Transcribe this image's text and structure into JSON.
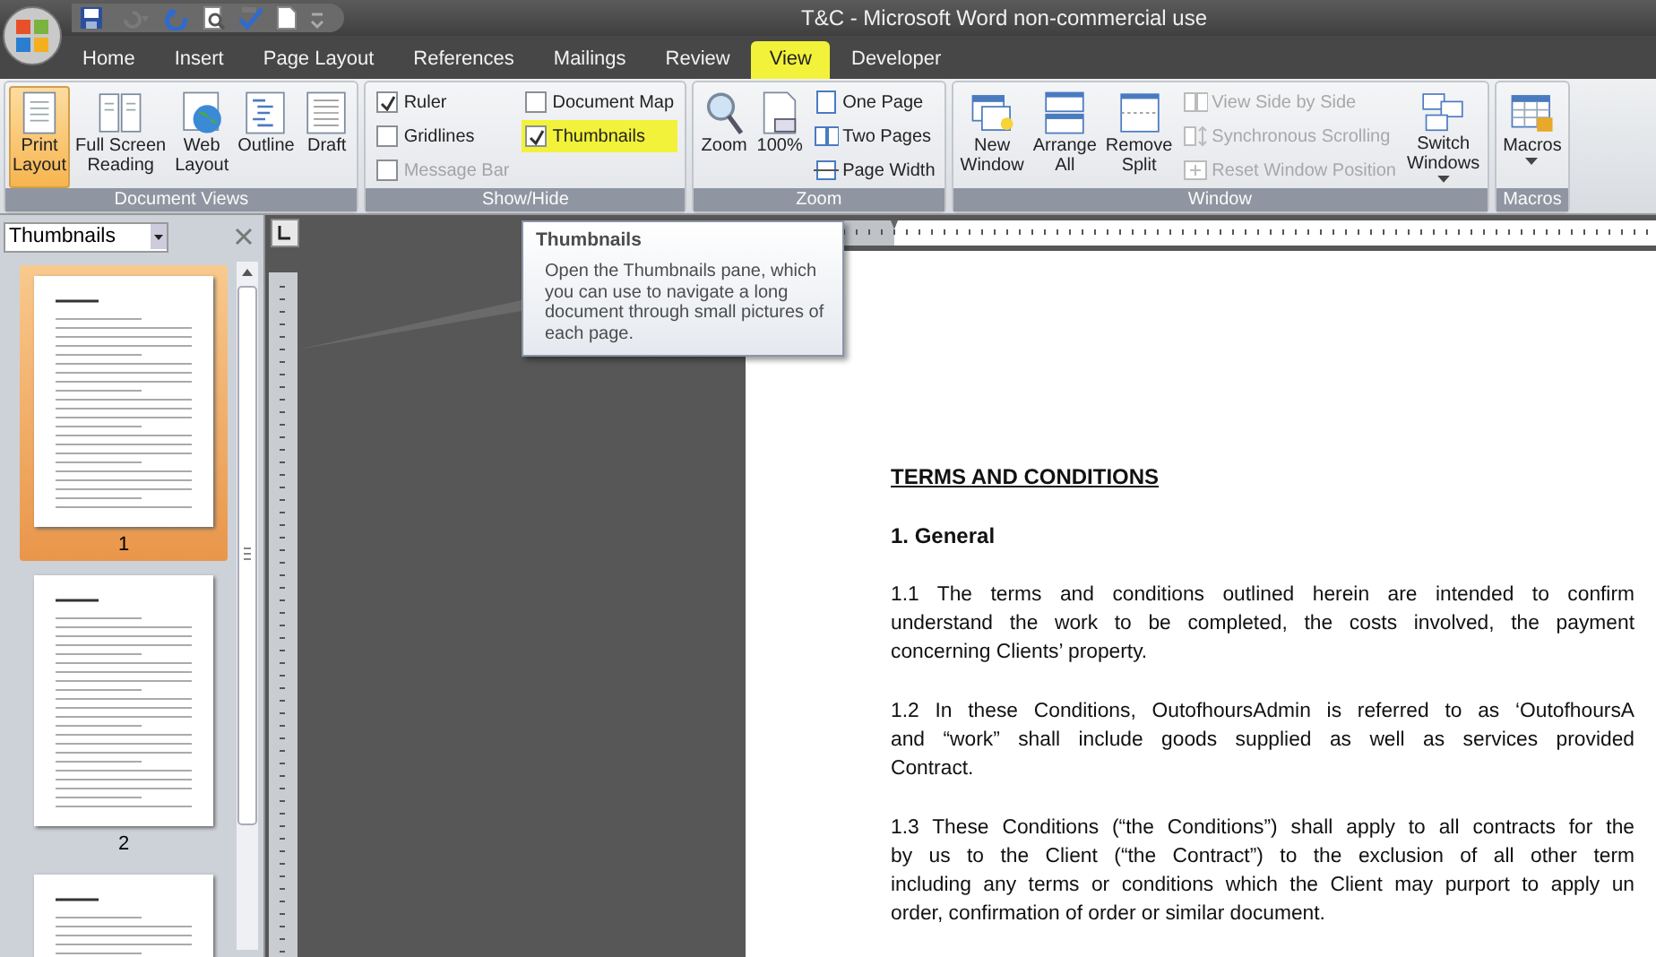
{
  "window": {
    "title": "T&C - Microsoft Word non-commercial use"
  },
  "tabs": [
    {
      "label": "Home",
      "selected": false,
      "highlighted": false
    },
    {
      "label": "Insert",
      "selected": false,
      "highlighted": false
    },
    {
      "label": "Page Layout",
      "selected": false,
      "highlighted": false
    },
    {
      "label": "References",
      "selected": false,
      "highlighted": false
    },
    {
      "label": "Mailings",
      "selected": false,
      "highlighted": false
    },
    {
      "label": "Review",
      "selected": false,
      "highlighted": false
    },
    {
      "label": "View",
      "selected": true,
      "highlighted": true
    },
    {
      "label": "Developer",
      "selected": false,
      "highlighted": false
    }
  ],
  "ribbon": {
    "groups": [
      {
        "label": "Document Views",
        "items": [
          {
            "kind": "large",
            "label_lines": [
              "Print",
              "Layout"
            ],
            "selected": true,
            "disabled": false
          },
          {
            "kind": "large",
            "label_lines": [
              "Full Screen",
              "Reading"
            ],
            "selected": false,
            "disabled": false
          },
          {
            "kind": "large",
            "label_lines": [
              "Web",
              "Layout"
            ],
            "selected": false,
            "disabled": false
          },
          {
            "kind": "large",
            "label_lines": [
              "Outline"
            ],
            "selected": false,
            "disabled": false
          },
          {
            "kind": "large",
            "label_lines": [
              "Draft"
            ],
            "selected": false,
            "disabled": false
          }
        ]
      },
      {
        "label": "Show/Hide",
        "items": [
          {
            "kind": "checkbox",
            "label": "Ruler",
            "checked": true,
            "disabled": false,
            "highlighted": false
          },
          {
            "kind": "checkbox",
            "label": "Gridlines",
            "checked": false,
            "disabled": false,
            "highlighted": false
          },
          {
            "kind": "checkbox",
            "label": "Message Bar",
            "checked": false,
            "disabled": true,
            "highlighted": false
          },
          {
            "kind": "checkbox",
            "label": "Document Map",
            "checked": false,
            "disabled": false,
            "highlighted": false
          },
          {
            "kind": "checkbox",
            "label": "Thumbnails",
            "checked": true,
            "disabled": false,
            "highlighted": true
          }
        ]
      },
      {
        "label": "Zoom",
        "items": [
          {
            "kind": "large",
            "label_lines": [
              "Zoom"
            ],
            "selected": false,
            "disabled": false
          },
          {
            "kind": "large",
            "label_lines": [
              "100%"
            ],
            "selected": false,
            "disabled": false
          },
          {
            "kind": "small",
            "label": "One Page",
            "disabled": false
          },
          {
            "kind": "small",
            "label": "Two Pages",
            "disabled": false
          },
          {
            "kind": "small",
            "label": "Page Width",
            "disabled": false
          }
        ]
      },
      {
        "label": "Window",
        "items": [
          {
            "kind": "large",
            "label_lines": [
              "New",
              "Window"
            ],
            "selected": false,
            "disabled": false
          },
          {
            "kind": "large",
            "label_lines": [
              "Arrange",
              "All"
            ],
            "selected": false,
            "disabled": false
          },
          {
            "kind": "large",
            "label_lines": [
              "Remove",
              "Split"
            ],
            "selected": false,
            "disabled": false
          },
          {
            "kind": "small",
            "label": "View Side by Side",
            "disabled": true
          },
          {
            "kind": "small",
            "label": "Synchronous Scrolling",
            "disabled": true
          },
          {
            "kind": "small",
            "label": "Reset Window Position",
            "disabled": true
          },
          {
            "kind": "large",
            "label_lines": [
              "Switch",
              "Windows"
            ],
            "selected": false,
            "disabled": false,
            "dropdown": true
          }
        ]
      },
      {
        "label": "Macros",
        "items": [
          {
            "kind": "large",
            "label_lines": [
              "Macros"
            ],
            "selected": false,
            "disabled": false,
            "dropdown": true
          }
        ]
      }
    ]
  },
  "thumbnails_pane": {
    "dropdown": "Thumbnails",
    "pages": [
      {
        "label": "1",
        "selected": true
      },
      {
        "label": "2",
        "selected": false
      },
      {
        "selected": false
      }
    ]
  },
  "tooltip": {
    "title": "Thumbnails",
    "text": "Open the Thumbnails pane, which you can use to navigate a long document through small pictures of each page."
  },
  "document": {
    "paragraphs": [
      {
        "kind": "heading",
        "lines": [
          "TERMS AND CONDITIONS"
        ]
      },
      {
        "kind": "subheading",
        "lines": [
          "1. General"
        ]
      },
      {
        "kind": "body",
        "lines": [
          "1.1 The terms and conditions outlined herein are intended to confirm",
          "understand the work to be completed, the costs involved, the payment",
          "concerning Clients’ property."
        ]
      },
      {
        "kind": "body",
        "lines": [
          "1.2 In these Conditions, OutofhoursAdmin is referred to as ‘OutofhoursA",
          "and “work” shall include goods supplied as well as services provided",
          "Contract."
        ]
      },
      {
        "kind": "body",
        "lines": [
          "1.3 These Conditions (“the Conditions”) shall apply to all contracts for the",
          "by us to the Client (“the Contract”) to the exclusion of all other term",
          "including any terms or conditions which the Client may purport to apply un",
          "order, confirmation of order or similar document."
        ]
      }
    ]
  }
}
